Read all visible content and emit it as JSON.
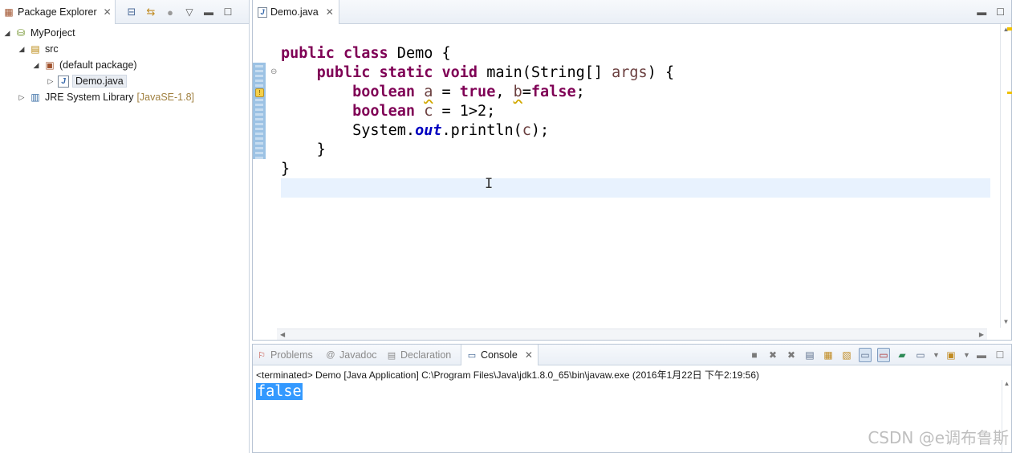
{
  "package_explorer": {
    "tab_label": "Package Explorer",
    "close_glyph": "✕",
    "tree": [
      {
        "label": "MyPorject",
        "icon": "project-icon"
      },
      {
        "label": "src",
        "icon": "source-folder-icon"
      },
      {
        "label": "(default package)",
        "icon": "package-icon"
      },
      {
        "label": "Demo.java",
        "icon": "java-file-icon"
      },
      {
        "label": "JRE System Library",
        "suffix": "[JavaSE-1.8]",
        "icon": "library-icon"
      }
    ]
  },
  "editor": {
    "tab_label": "Demo.java",
    "close_glyph": "✕",
    "code": {
      "line1": {
        "kw1": "public",
        "kw2": "class",
        "rest": " Demo {"
      },
      "line2": {
        "kw1": "public",
        "kw2": "static",
        "kw3": "void",
        "mid": " main(String[] ",
        "arg": "args",
        "end": ") {"
      },
      "line3": {
        "kw": "boolean",
        "v1": "a",
        "eq": " = ",
        "kwtrue": "true",
        "comma": ", ",
        "v2": "b",
        "eq2": "=",
        "kwfalse": "false",
        "semi": ";"
      },
      "line4": {
        "kw": "boolean",
        "v": "c",
        "rest": " = 1>2;"
      },
      "line5": {
        "pre": "System.",
        "field": "out",
        "mid": ".println(",
        "v": "c",
        "end": ");"
      },
      "line6": "}",
      "line7": "}"
    }
  },
  "console": {
    "tabs": [
      {
        "label": "Problems",
        "icon": "problems-icon"
      },
      {
        "label": "Javadoc",
        "icon": "javadoc-icon"
      },
      {
        "label": "Declaration",
        "icon": "declaration-icon"
      },
      {
        "label": "Console",
        "icon": "console-icon",
        "active": true
      }
    ],
    "close_glyph": "✕",
    "status": "<terminated> Demo [Java Application] C:\\Program Files\\Java\\jdk1.8.0_65\\bin\\javaw.exe (2016年1月22日 下午2:19:56)",
    "output": "false"
  },
  "watermark": "CSDN @e调布鲁斯",
  "colors": {
    "keyword": "#7f0055",
    "static_field": "#0000c0",
    "selection": "#3399ff",
    "current_line": "#e8f2fe"
  }
}
